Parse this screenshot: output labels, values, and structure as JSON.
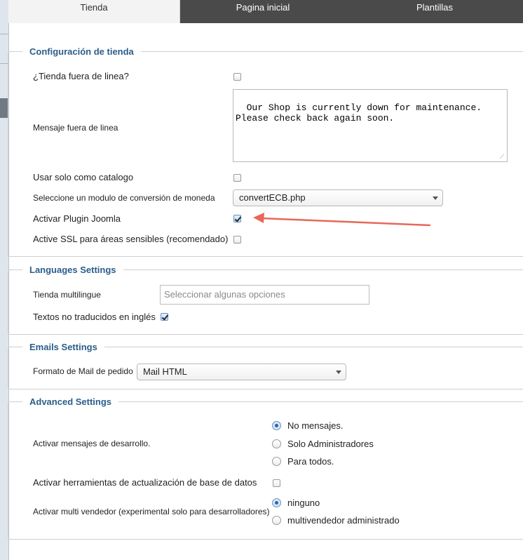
{
  "tabs": [
    {
      "label": "Tienda",
      "active": true
    },
    {
      "label": "Pagina inicial",
      "active": false
    },
    {
      "label": "Plantillas",
      "active": false
    }
  ],
  "tienda": {
    "legend": "Configuración de tienda",
    "offline_label": "¿Tienda fuera de linea?",
    "offline_checked": false,
    "offline_msg_label": "Mensaje fuera de linea",
    "offline_msg_value": "Our Shop is currently down for maintenance. Please check back again soon.",
    "catalog_label": "Usar solo como catalogo",
    "catalog_checked": false,
    "currency_module_label": "Seleccione un modulo de conversión de moneda",
    "currency_module_value": "convertECB.php",
    "joomla_plugin_label": "Activar Plugin Joomla",
    "joomla_plugin_checked": true,
    "ssl_label": "Active SSL para áreas sensibles (recomendado)",
    "ssl_checked": false
  },
  "languages": {
    "legend": "Languages Settings",
    "multilang_label": "Tienda multilingue",
    "multilang_placeholder": "Seleccionar algunas opciones",
    "untranslated_label": "Textos no traducidos en inglés",
    "untranslated_checked": true
  },
  "emails": {
    "legend": "Emails Settings",
    "mail_format_label": "Formato de Mail de pedido",
    "mail_format_value": "Mail HTML"
  },
  "advanced": {
    "legend": "Advanced Settings",
    "debug_label": "Activar mensajes de desarrollo.",
    "debug_options": [
      "No mensajes.",
      "Solo Administradores",
      "Para todos."
    ],
    "debug_selected": 0,
    "dbupdate_label": "Activar herramientas de actualización de base de datos",
    "dbupdate_checked": false,
    "multivendor_label": "Activar multi vendedor (experimental solo para desarrolladores)",
    "multivendor_options": [
      "ninguno",
      "multivendedor administrado"
    ],
    "multivendor_selected": 0
  },
  "colors": {
    "legend_text": "#2b5d8a",
    "tab_bar": "#4a4a4a",
    "annotation_arrow": "#e8675a"
  }
}
